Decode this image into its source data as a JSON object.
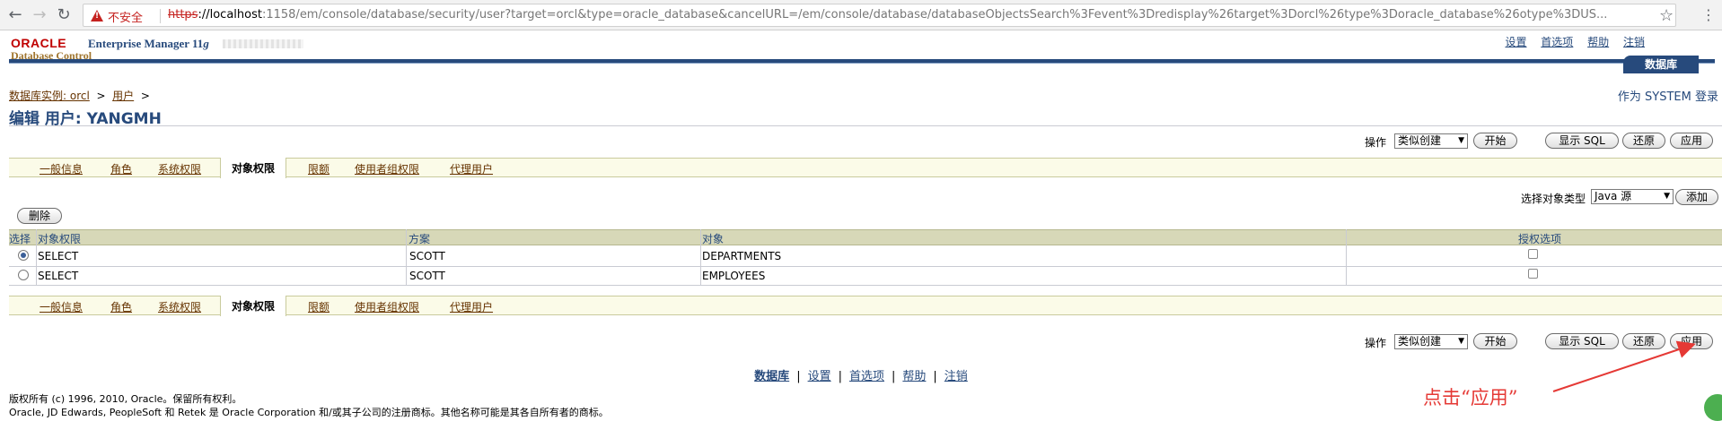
{
  "browser": {
    "insecure_label": "不安全",
    "url_scheme": "https",
    "url_host": "://localhost",
    "url_path": ":1158/em/console/database/security/user?target=orcl&type=oracle_database&cancelURL=/em/console/database/databaseObjectsSearch%3Fevent%3Dredisplay%26target%3Dorcl%26type%3Doracle_database%26otype%3DUS..."
  },
  "header": {
    "oracle_logo": "ORACLE",
    "product_title": "Enterprise Manager 11",
    "product_version": "g",
    "subtitle": "Database Control",
    "global_links": [
      "设置",
      "首选项",
      "帮助",
      "注销"
    ],
    "database_tab": "数据库"
  },
  "breadcrumb": {
    "instance": "数据库实例: orcl",
    "users": "用户",
    "sep": ">"
  },
  "login_as": "作为 SYSTEM 登录",
  "page_title": "编辑 用户: YANGMH",
  "actions": {
    "operation_label": "操作",
    "operation_value": "类似创建",
    "start": "开始",
    "show_sql": "显示 SQL",
    "revert": "还原",
    "apply": "应用"
  },
  "tabs": [
    {
      "label": "一般信息"
    },
    {
      "label": "角色"
    },
    {
      "label": "系统权限"
    },
    {
      "label": "对象权限"
    },
    {
      "label": "限额"
    },
    {
      "label": "使用者组权限"
    },
    {
      "label": "代理用户"
    }
  ],
  "object_type": {
    "label": "选择对象类型",
    "value": "Java 源",
    "add": "添加"
  },
  "delete_button": "删除",
  "table": {
    "columns": [
      "选择",
      "对象权限",
      "方案",
      "对象",
      "授权选项"
    ],
    "rows": [
      {
        "selected": true,
        "privilege": "SELECT",
        "schema": "SCOTT",
        "object": "DEPARTMENTS",
        "grant": false
      },
      {
        "selected": false,
        "privilege": "SELECT",
        "schema": "SCOTT",
        "object": "EMPLOYEES",
        "grant": false
      }
    ]
  },
  "footer": {
    "links": [
      "数据库",
      "设置",
      "首选项",
      "帮助",
      "注销"
    ],
    "separator": "|",
    "copyright_1": "版权所有 (c) 1996, 2010, Oracle。保留所有权利。",
    "copyright_2": "Oracle, JD Edwards, PeopleSoft 和 Retek 是 Oracle Corporation 和/或其子公司的注册商标。其他名称可能是其各自所有者的商标。"
  },
  "annotation": {
    "text": "点击“应用”",
    "color": "#e53935"
  },
  "colors": {
    "brand_blue": "#274a7c",
    "oracle_red": "#c00000",
    "tab_bg": "#fbfbe8",
    "table_header_bg": "#d7d8b8"
  }
}
